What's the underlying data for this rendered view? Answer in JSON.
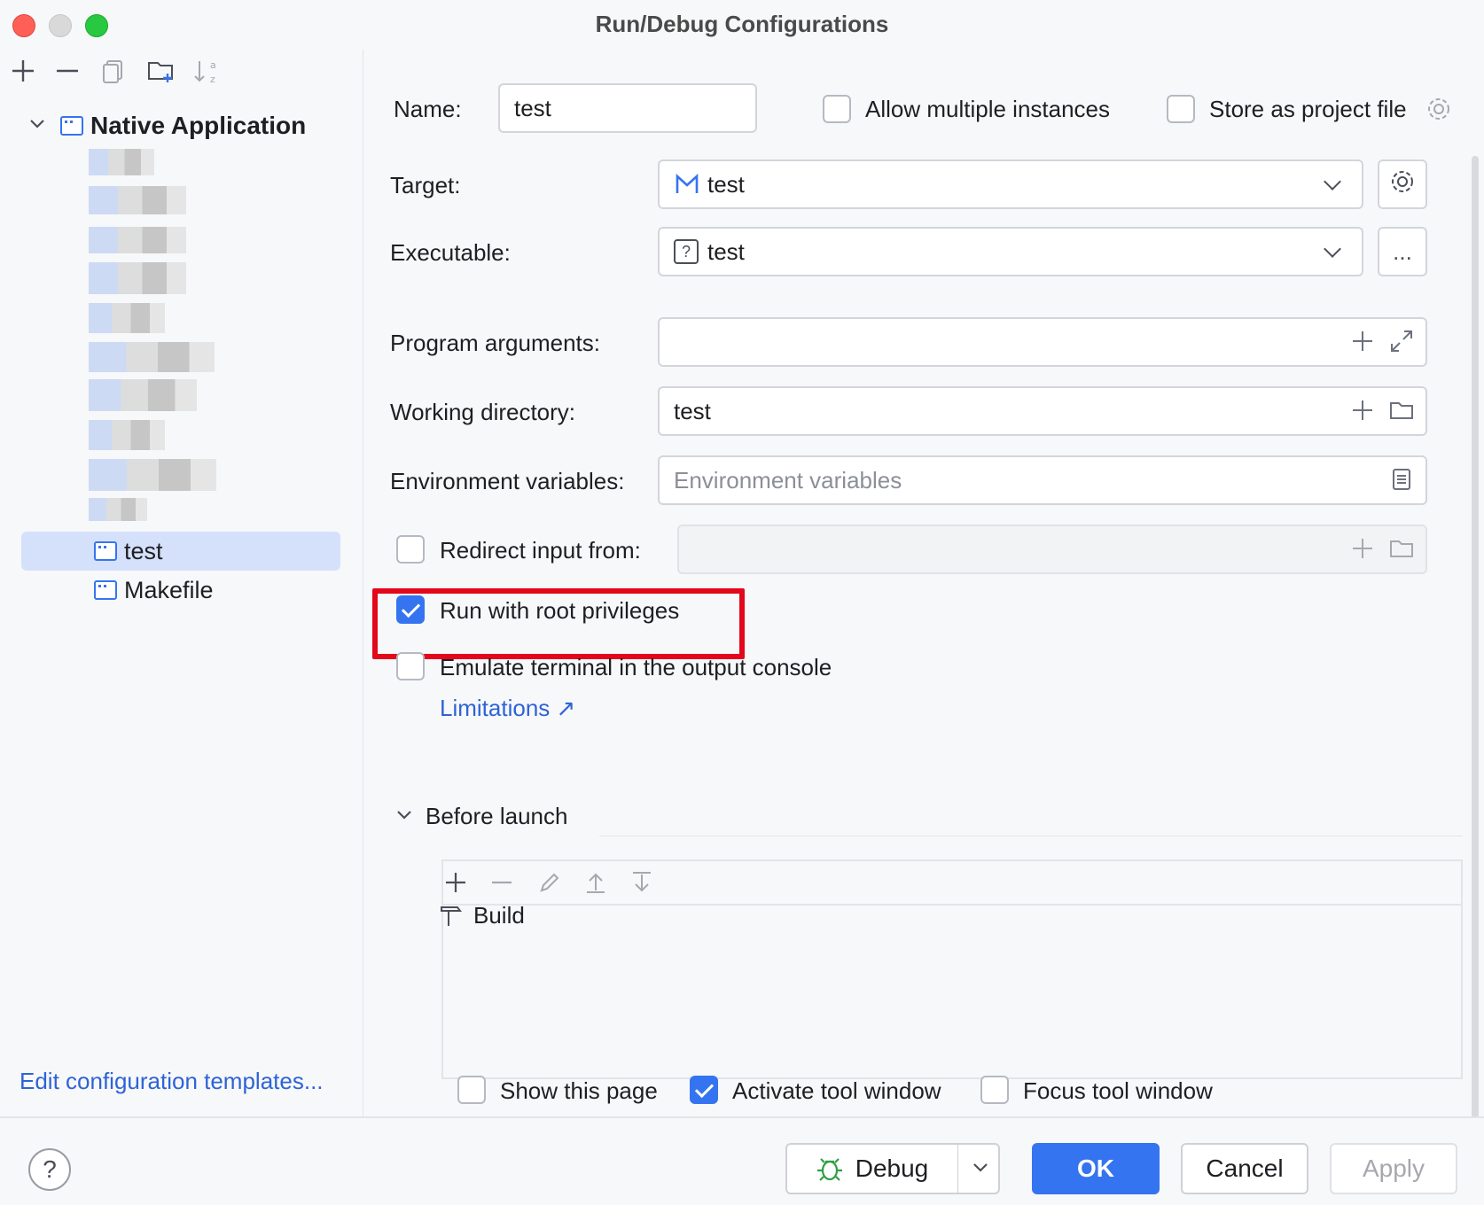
{
  "window": {
    "title": "Run/Debug Configurations"
  },
  "sidebar": {
    "toolbar": [
      "add-icon",
      "remove-icon",
      "copy-icon",
      "new-folder-icon",
      "sort-icon"
    ],
    "root": {
      "label": "Native Application",
      "expanded": true
    },
    "items": [
      {
        "label": "test",
        "selected": true
      },
      {
        "label": "Makefile",
        "selected": false
      }
    ],
    "edit_templates": "Edit configuration templates..."
  },
  "form": {
    "name_label": "Name:",
    "name_value": "test",
    "allow_multiple_label": "Allow multiple instances",
    "allow_multiple_checked": false,
    "store_project_label": "Store as project file",
    "store_project_checked": false,
    "target_label": "Target:",
    "target_value": "test",
    "executable_label": "Executable:",
    "executable_value": "test",
    "executable_more": "...",
    "program_args_label": "Program arguments:",
    "program_args_value": "",
    "working_dir_label": "Working directory:",
    "working_dir_value": "test",
    "env_vars_label": "Environment variables:",
    "env_vars_placeholder": "Environment variables",
    "redirect_label": "Redirect input from:",
    "redirect_checked": false,
    "root_priv_label": "Run with root privileges",
    "root_priv_checked": true,
    "emulate_label": "Emulate terminal in the output console",
    "emulate_checked": false,
    "limitations_link": "Limitations ↗"
  },
  "before_launch": {
    "title": "Before launch",
    "tasks": [
      {
        "label": "Build"
      }
    ],
    "show_page_label": "Show this page",
    "show_page_checked": false,
    "activate_label": "Activate tool window",
    "activate_checked": true,
    "focus_label": "Focus tool window",
    "focus_checked": false
  },
  "buttons": {
    "help": "?",
    "debug": "Debug",
    "ok": "OK",
    "cancel": "Cancel",
    "apply": "Apply"
  },
  "colors": {
    "accent": "#3574f0",
    "highlight": "#e3071b",
    "link": "#2e63d6",
    "selection": "#d5e1fb"
  }
}
